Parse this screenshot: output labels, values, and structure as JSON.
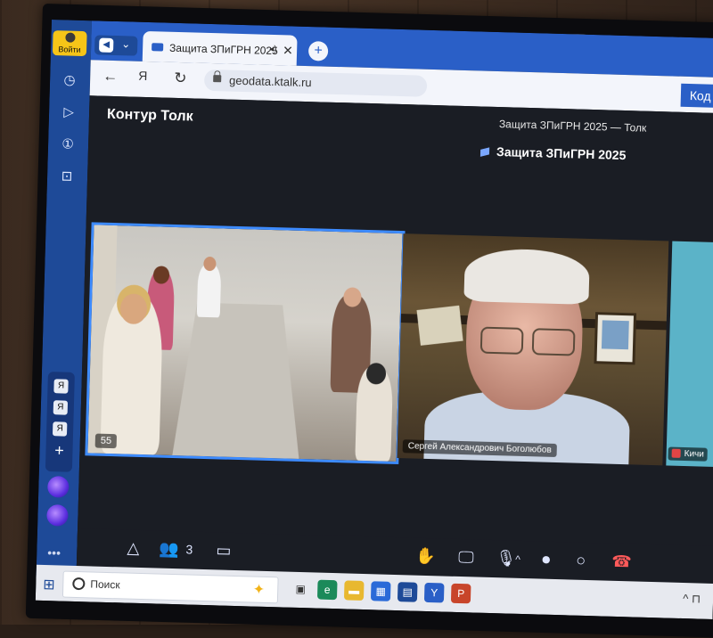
{
  "sidebar": {
    "login_label": "Войти",
    "ya_labels": [
      "Я",
      "Я",
      "Я"
    ],
    "plus_label": "+",
    "more_label": "•••",
    "icons": [
      "clock-icon",
      "play-icon",
      "tab-one-icon",
      "screenshot-icon",
      "plus-icon",
      "alice-icon",
      "alice-icon",
      "more-icon"
    ]
  },
  "browser": {
    "tab_title": "Защита ЗПиГРН 2025",
    "tab_close": "✕",
    "new_tab": "+",
    "url": "geodata.ktalk.ru",
    "right_button": "Код з"
  },
  "app": {
    "brand": "Контур Толк",
    "window_title": "Защита ЗПиГРН 2025 — Толк",
    "meeting_title": "Защита ЗПиГРН 2025"
  },
  "tiles": {
    "room_count": "55",
    "speaker_name": "Сергей Александрович Боголюбов",
    "far_name": "Кичи"
  },
  "controls": {
    "participants_count": "3"
  },
  "taskbar": {
    "search_placeholder": "Поиск"
  },
  "colors": {
    "sidebar": "#1e4a98",
    "tabbar": "#2a5fc7",
    "active_tile_border": "#3d8bff",
    "login_button": "#f5c518"
  }
}
